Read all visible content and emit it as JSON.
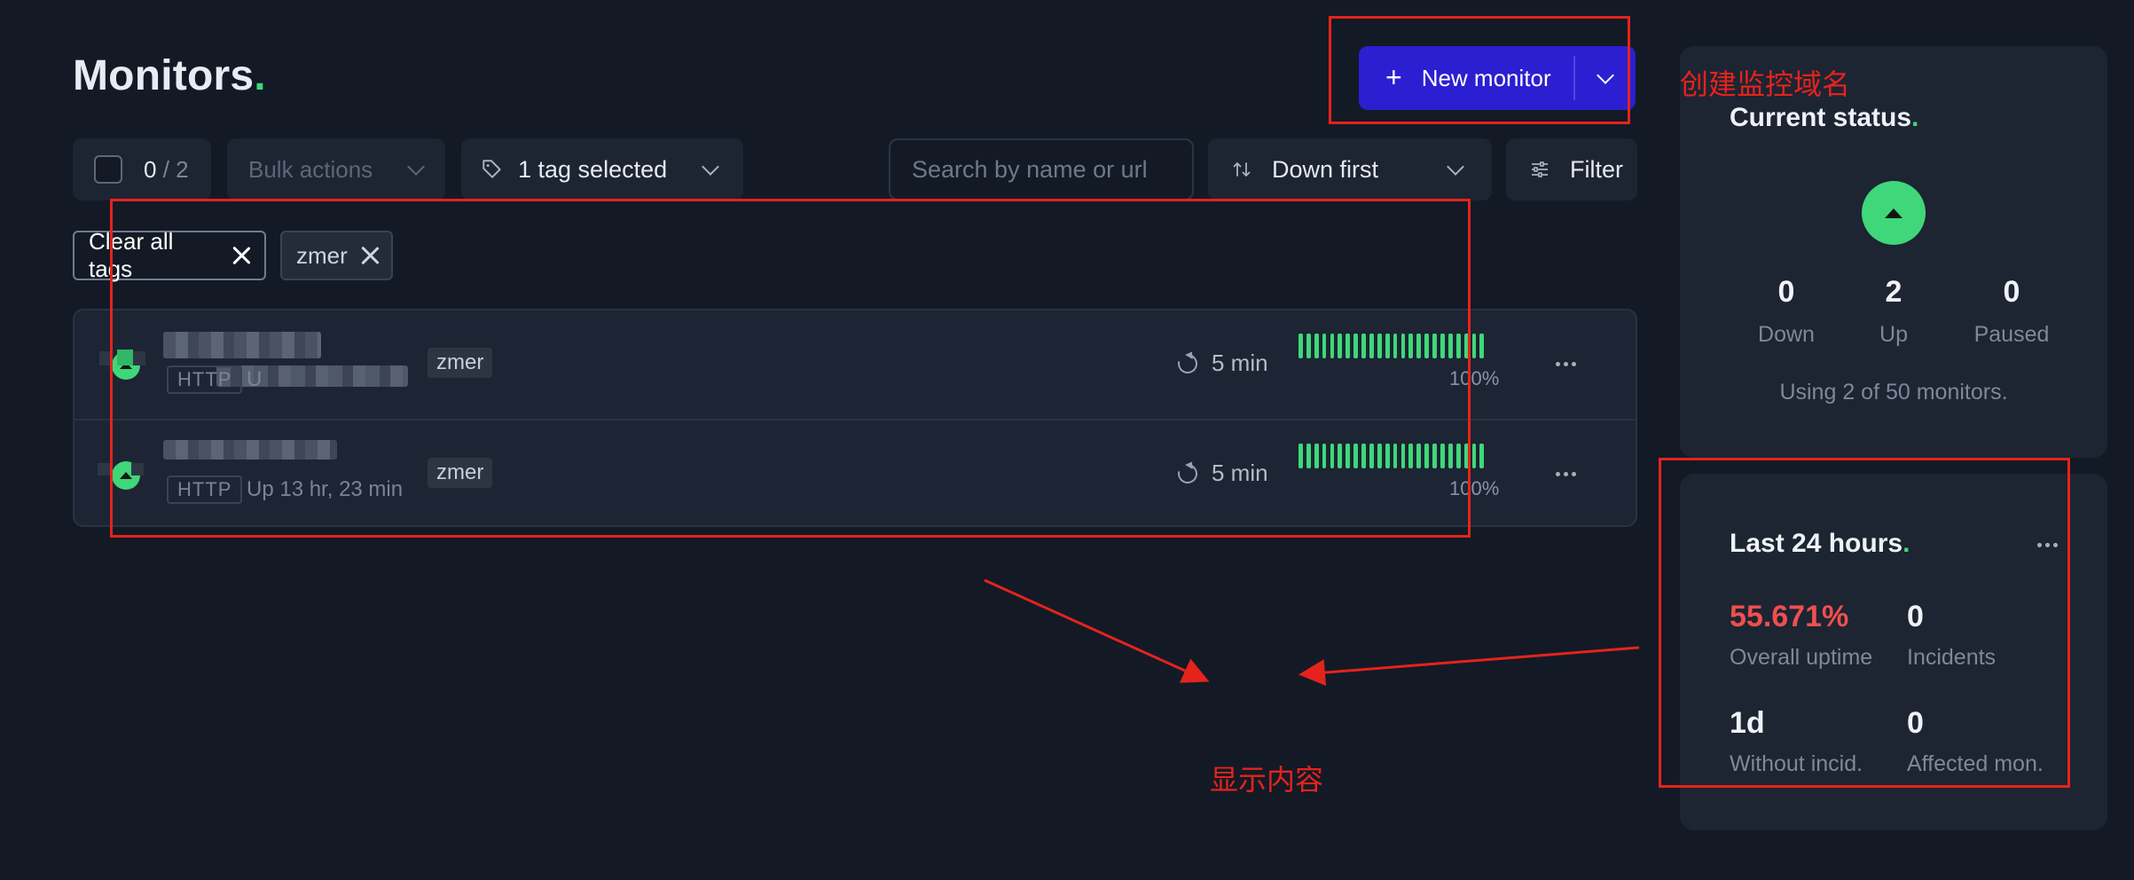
{
  "page": {
    "title": "Monitors",
    "title_dot": "."
  },
  "new_monitor": {
    "label": "New monitor",
    "plus": "+"
  },
  "toolbar": {
    "selected": "0",
    "total": "/ 2",
    "bulk_actions": "Bulk actions",
    "tags": "1 tag selected",
    "search_placeholder": "Search by name or url",
    "sort": "Down first",
    "filter": "Filter"
  },
  "chips": {
    "clear_all": "Clear all tags",
    "tag": "zmer"
  },
  "monitors": [
    {
      "protocol": "HTTP",
      "status_text": "U",
      "tag": "zmer",
      "interval": "5 min",
      "uptime": "100%",
      "bars": 24
    },
    {
      "protocol": "HTTP",
      "status_text": "Up 13 hr, 23 min",
      "tag": "zmer",
      "interval": "5 min",
      "uptime": "100%",
      "bars": 24
    }
  ],
  "current_status": {
    "title": "Current status",
    "title_dot": ".",
    "down": {
      "value": "0",
      "label": "Down"
    },
    "up": {
      "value": "2",
      "label": "Up"
    },
    "paused": {
      "value": "0",
      "label": "Paused"
    },
    "usage": "Using 2 of 50 monitors."
  },
  "last24": {
    "title": "Last 24 hours",
    "title_dot": ".",
    "uptime": {
      "value": "55.671%",
      "label": "Overall uptime"
    },
    "incidents": {
      "value": "0",
      "label": "Incidents"
    },
    "without": {
      "value": "1d",
      "label": "Without incid."
    },
    "affected": {
      "value": "0",
      "label": "Affected mon."
    }
  },
  "annotations": {
    "create_label": "创建监控域名",
    "content_label": "显示内容"
  },
  "colors": {
    "background": "#131a26",
    "panel": "#1d2432",
    "accent_green": "#3fd77a",
    "button_blue": "#2b1fd1",
    "uptime_red": "#ef4f4f",
    "annotation_red": "#e5231c"
  }
}
